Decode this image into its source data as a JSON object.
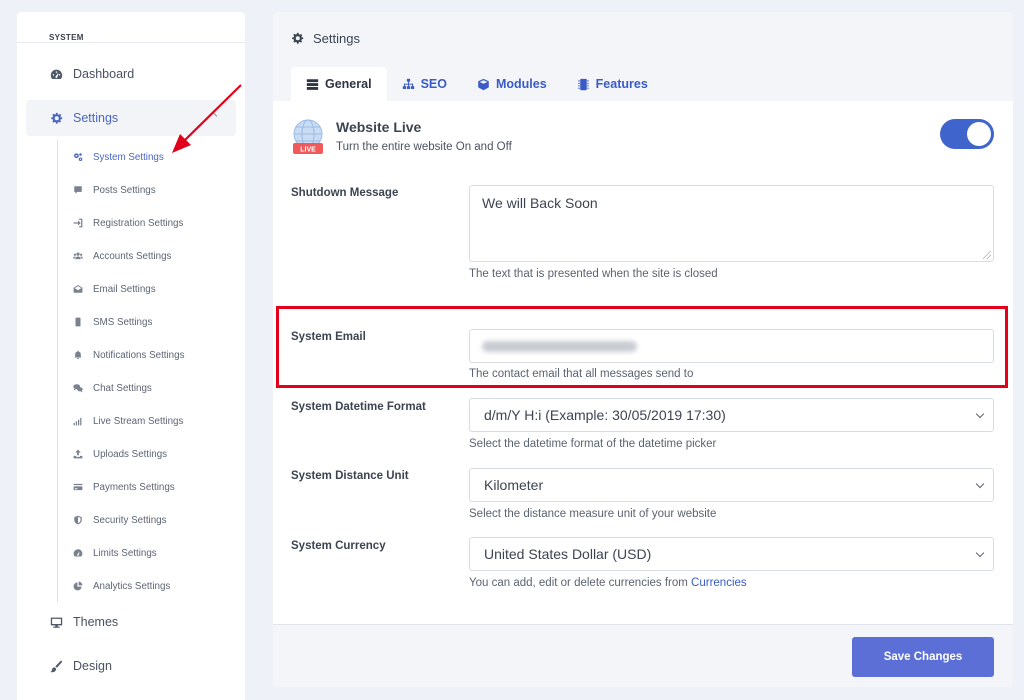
{
  "sidebar": {
    "section_label": "SYSTEM",
    "main_items": [
      {
        "label": "Dashboard",
        "icon": "dashboard-icon"
      },
      {
        "label": "Settings",
        "icon": "gear-icon"
      },
      {
        "label": "Themes",
        "icon": "monitor-icon"
      },
      {
        "label": "Design",
        "icon": "brush-icon"
      }
    ],
    "sub_items": [
      {
        "label": "System Settings",
        "icon": "cogs-icon"
      },
      {
        "label": "Posts Settings",
        "icon": "comment-icon"
      },
      {
        "label": "Registration Settings",
        "icon": "sign-in-icon"
      },
      {
        "label": "Accounts Settings",
        "icon": "users-icon"
      },
      {
        "label": "Email Settings",
        "icon": "envelope-icon"
      },
      {
        "label": "SMS Settings",
        "icon": "mobile-icon"
      },
      {
        "label": "Notifications Settings",
        "icon": "bell-icon"
      },
      {
        "label": "Chat Settings",
        "icon": "comments-icon"
      },
      {
        "label": "Live Stream Settings",
        "icon": "signal-icon"
      },
      {
        "label": "Uploads Settings",
        "icon": "upload-icon"
      },
      {
        "label": "Payments Settings",
        "icon": "credit-card-icon"
      },
      {
        "label": "Security Settings",
        "icon": "shield-icon"
      },
      {
        "label": "Limits Settings",
        "icon": "gauge-icon"
      },
      {
        "label": "Analytics Settings",
        "icon": "pie-chart-icon"
      }
    ]
  },
  "main": {
    "title": "Settings",
    "tabs": [
      {
        "label": "General",
        "icon": "server-icon"
      },
      {
        "label": "SEO",
        "icon": "sitemap-icon"
      },
      {
        "label": "Modules",
        "icon": "cube-icon"
      },
      {
        "label": "Features",
        "icon": "microchip-icon"
      }
    ],
    "website_live": {
      "title": "Website Live",
      "description": "Turn the entire website On and Off",
      "badge": "LIVE",
      "enabled": true
    },
    "shutdown_message": {
      "label": "Shutdown Message",
      "value": "We will Back Soon",
      "help": "The text that is presented when the site is closed"
    },
    "system_email": {
      "label": "System Email",
      "help": "The contact email that all messages send to"
    },
    "datetime_format": {
      "label": "System Datetime Format",
      "value": "d/m/Y H:i (Example: 30/05/2019 17:30)",
      "help": "Select the datetime format of the datetime picker"
    },
    "distance_unit": {
      "label": "System Distance Unit",
      "value": "Kilometer",
      "help": "Select the distance measure unit of your website"
    },
    "currency": {
      "label": "System Currency",
      "value": "United States Dollar (USD)",
      "help": "You can add, edit or delete currencies from",
      "help_link": "Currencies"
    },
    "save_label": "Save Changes"
  },
  "colors": {
    "accent": "#3f64cc",
    "button": "#5b6fd6",
    "annotation": "#e3001b"
  }
}
